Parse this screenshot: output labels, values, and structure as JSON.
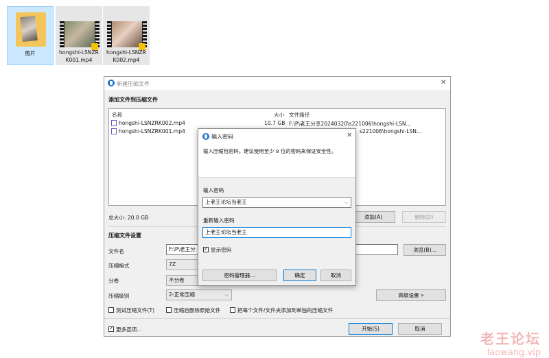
{
  "desktop": {
    "files": [
      {
        "label_line1": "图片",
        "label_line2": ""
      },
      {
        "label_line1": "hongshi-LSNZR",
        "label_line2": "K001.mp4"
      },
      {
        "label_line1": "hongshi-LSNZR",
        "label_line2": "K002.mp4"
      }
    ]
  },
  "main_dialog": {
    "title": "新建压缩文件",
    "add_section": "添加文件到压缩文件",
    "columns": {
      "name": "名称",
      "size": "大小",
      "path": "文件路径"
    },
    "rows": [
      {
        "name": "hongshi-LSNZRK002.mp4",
        "size": "10.7 GB",
        "path": "F:\\P\\老王分享20240320\\s221006\\hongshi-LSN..."
      },
      {
        "name": "hongshi-LSNZRK001.mp4",
        "size": "",
        "path": "s221006\\hongshi-LSN..."
      }
    ],
    "total_size": "总大小: 20.0 GB",
    "add_button": "添加(A)",
    "delete_button": "删除(D)",
    "settings_section": "压缩文件设置",
    "filename_label": "文件名",
    "filename_value": "F:\\P\\老王分",
    "browse_button": "浏览(B)...",
    "format_label": "压缩格式",
    "format_value": "7Z",
    "split_label": "分卷",
    "split_value": "不分卷",
    "level_label": "压缩级别",
    "level_value": "2-正常压缩",
    "advanced_button": "高级设置 »",
    "test_archive": "测试压缩文件(T)",
    "delete_after": "压缩后删除原始文件",
    "each_separate": "把每个文件/文件夹添加到单独的压缩文件",
    "more_options": "更多选项...",
    "start_button": "开始(S)",
    "cancel_button": "取消"
  },
  "password_dialog": {
    "title": "输入密码",
    "hint": "输入压缩包密码。建议使用至少 8 位的密码来保证安全性。",
    "enter_label": "输入密码",
    "enter_value": "上老王论坛当老王",
    "reenter_label": "重新输入密码",
    "reenter_value": "上老王论坛当老王",
    "show_password": "显示密码",
    "manager_button": "密码管理器...",
    "ok_button": "确定",
    "cancel_button": "取消"
  },
  "watermark": {
    "main": "老王论坛",
    "sub": "laowang.vip"
  },
  "colors": {
    "accent": "#0078d7",
    "app_icon": "#1f6fd0",
    "selection": "#cce8ff",
    "watermark": "#f2b8b8"
  }
}
